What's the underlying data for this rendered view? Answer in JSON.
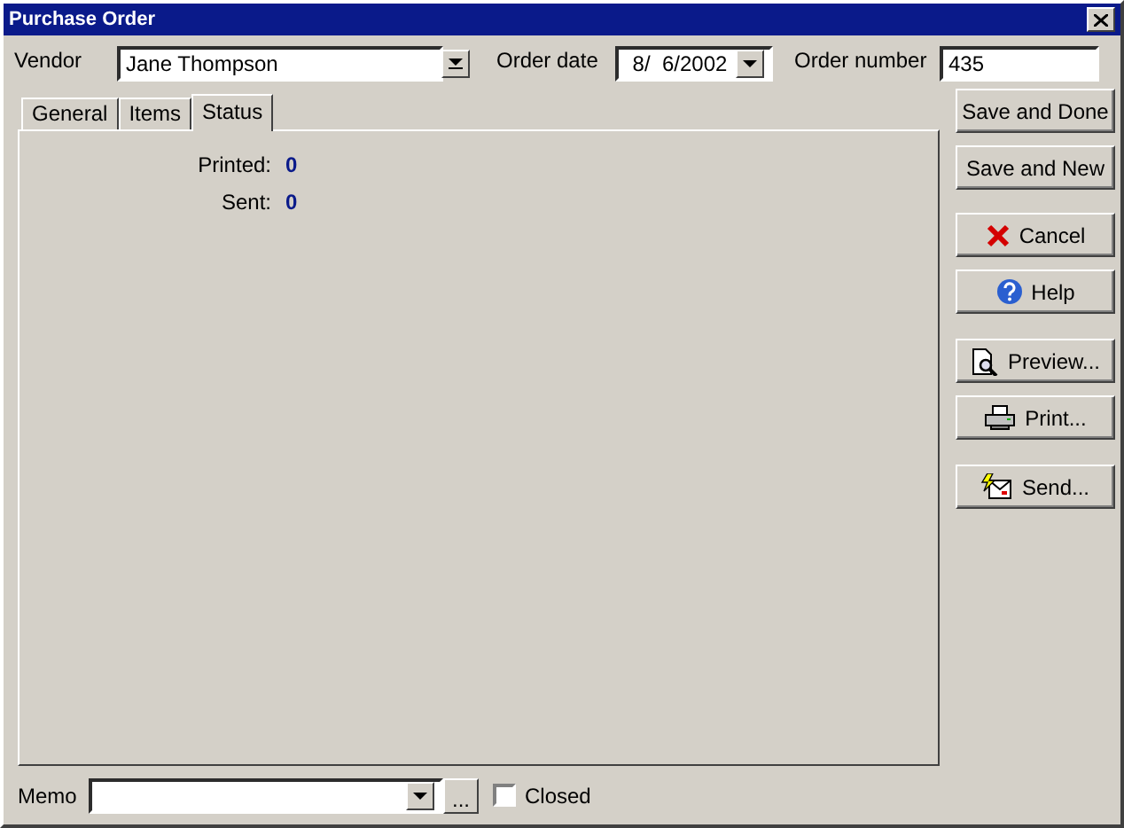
{
  "window": {
    "title": "Purchase Order"
  },
  "header": {
    "vendor_label": "Vendor",
    "vendor": "Jane Thompson",
    "date_label": "Order date",
    "date": "8/  6/2002",
    "number_label": "Order number",
    "number": "435"
  },
  "tabs": [
    {
      "label": "General",
      "selected": false
    },
    {
      "label": "Items",
      "selected": false
    },
    {
      "label": "Status",
      "selected": true
    }
  ],
  "status": [
    {
      "label": "Printed:",
      "value": "0"
    },
    {
      "label": "Sent:",
      "value": "0"
    }
  ],
  "buttons": [
    {
      "label": "Save and Done",
      "kind": "plain"
    },
    {
      "label": "Save and New",
      "kind": "plain"
    },
    {
      "label": "Cancel",
      "kind": "cancel"
    },
    {
      "label": "Help",
      "kind": "help"
    },
    {
      "label": "Preview...",
      "kind": "preview"
    },
    {
      "label": "Print...",
      "kind": "print"
    },
    {
      "label": "Send...",
      "kind": "send"
    }
  ],
  "footer": {
    "memo_label": "Memo",
    "browse": "...",
    "closed_label": "Closed",
    "closed": false
  }
}
